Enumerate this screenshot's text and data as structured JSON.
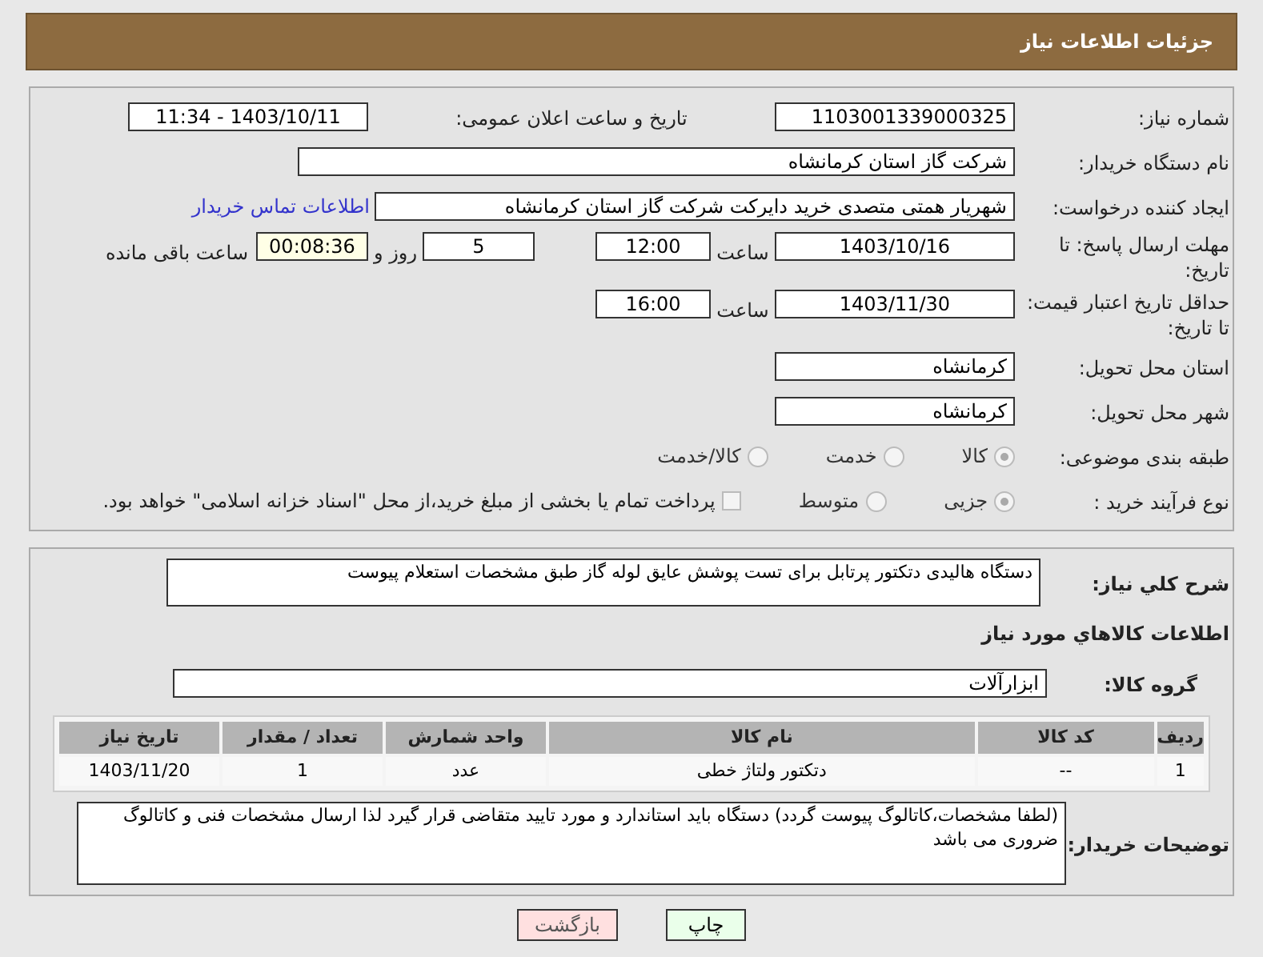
{
  "header": {
    "title": "جزئیات اطلاعات نیاز"
  },
  "need_number": {
    "label": "شماره نیاز:",
    "value": "1103001339000325"
  },
  "announce": {
    "label": "تاریخ و ساعت اعلان عمومی:",
    "value": "1403/10/11 - 11:34"
  },
  "buyer": {
    "label": "نام دستگاه خریدار:",
    "value": "شرکت گاز استان کرمانشاه"
  },
  "requester": {
    "label": "ایجاد کننده درخواست:",
    "value": "شهریار همتی متصدی خرید دایرکت شرکت گاز استان کرمانشاه",
    "link": "اطلاعات تماس خریدار"
  },
  "reply_deadline": {
    "label": "مهلت ارسال پاسخ: تا تاریخ:",
    "date": "1403/10/16",
    "time_label": "ساعت",
    "time": "12:00",
    "days": "5",
    "days_label": "روز و",
    "remaining": "00:08:36",
    "remaining_label": "ساعت باقی مانده"
  },
  "price_validity": {
    "label": "حداقل تاریخ اعتبار قیمت: تا تاریخ:",
    "date": "1403/11/30",
    "time_label": "ساعت",
    "time": "16:00"
  },
  "province": {
    "label": "استان محل تحویل:",
    "value": "کرمانشاه"
  },
  "city": {
    "label": "شهر محل تحویل:",
    "value": "کرمانشاه"
  },
  "category": {
    "label": "طبقه بندی موضوعی:",
    "options": [
      {
        "label": "کالا",
        "selected": true
      },
      {
        "label": "خدمت",
        "selected": false
      },
      {
        "label": "کالا/خدمت",
        "selected": false
      }
    ]
  },
  "purchase_type": {
    "label": "نوع فرآیند خرید :",
    "options": [
      {
        "label": "جزیی",
        "selected": true
      },
      {
        "label": "متوسط",
        "selected": false
      }
    ],
    "treasury": {
      "checked": false,
      "label": "پرداخت تمام یا بخشی از مبلغ خرید،از محل \"اسناد خزانه اسلامی\" خواهد بود."
    }
  },
  "summary": {
    "label": "شرح کلي نياز:",
    "value": "دستگاه هالیدی دتکتور پرتابل برای تست پوشش عایق لوله گاز  طبق مشخصات استعلام پیوست"
  },
  "goods_title": "اطلاعات کالاهاي مورد نياز",
  "goods_group": {
    "label": "گروه کالا:",
    "value": "ابزارآلات"
  },
  "table": {
    "columns": [
      "ردیف",
      "کد کالا",
      "نام کالا",
      "واحد شمارش",
      "تعداد / مقدار",
      "تاریخ نیاز"
    ],
    "rows": [
      [
        "1",
        "--",
        "دتکتور ولتاژ خطی",
        "عدد",
        "1",
        "1403/11/20"
      ]
    ]
  },
  "buyer_notes": {
    "label": "توضیحات خریدار:",
    "value": "(لطفا مشخصات،کاتالوگ پیوست گردد) دستگاه باید استاندارد و مورد تایید متقاضی قرار گیرد  لذا ارسال مشخصات فنی و کاتالوگ  ضروری می باشد"
  },
  "buttons": [
    {
      "kind": "print",
      "label": "چاپ"
    },
    {
      "kind": "back",
      "label": "بازگشت"
    }
  ]
}
